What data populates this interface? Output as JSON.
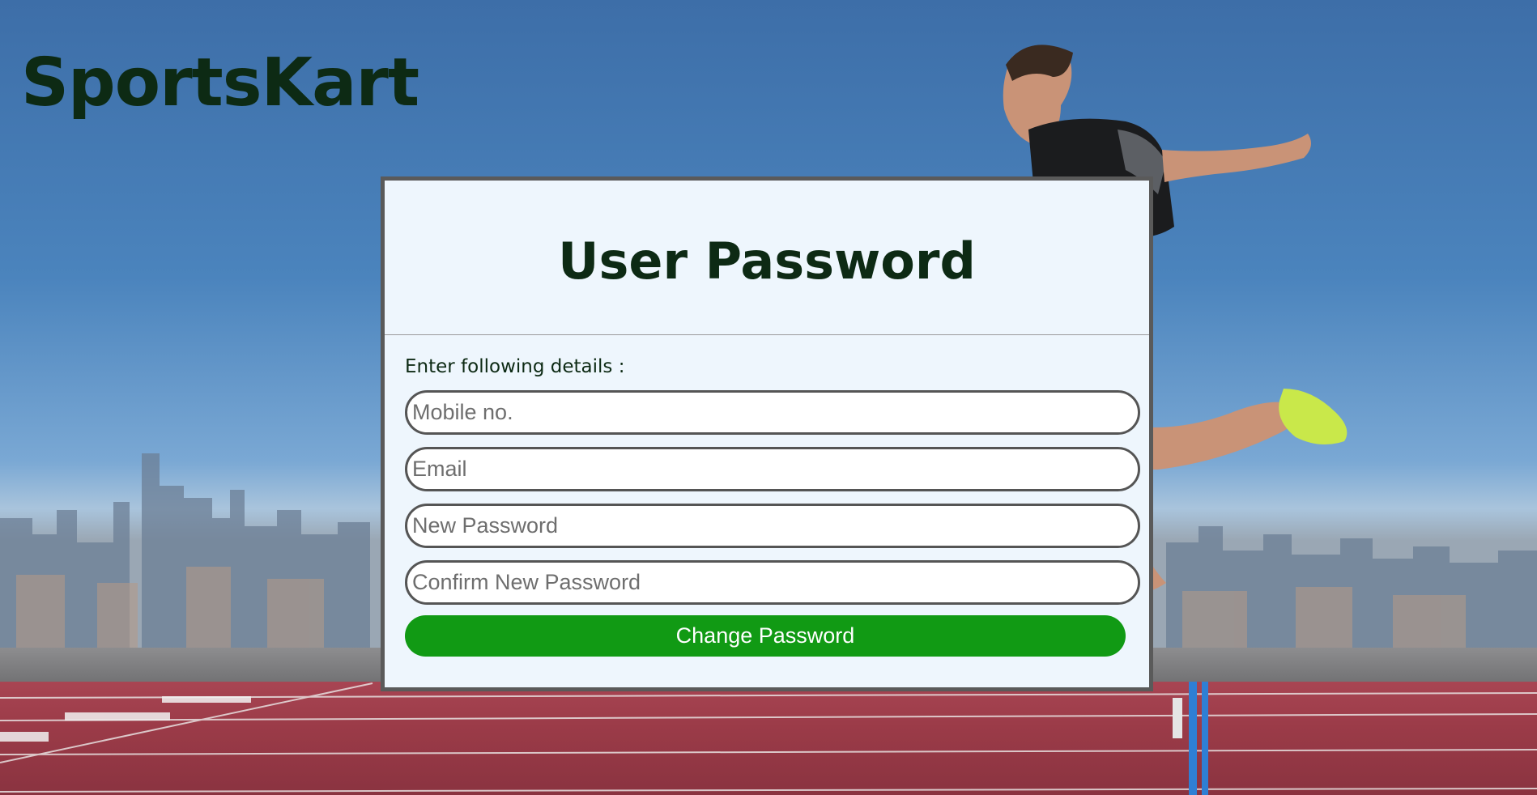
{
  "brand": {
    "name": "SportsKart"
  },
  "form": {
    "title": "User Password",
    "instructions": "Enter following details :",
    "fields": {
      "mobile_placeholder": "Mobile no.",
      "email_placeholder": "Email",
      "new_password_placeholder": "New Password",
      "confirm_password_placeholder": "Confirm New Password"
    },
    "submit_label": "Change Password"
  },
  "colors": {
    "brand_text": "#0d2a14",
    "card_background": "#eef6fd",
    "card_border": "#5a5a5a",
    "submit_button": "#119a14",
    "sky": "#4178b3",
    "track": "#9b3b48"
  },
  "background": {
    "scene": "athlete-hurdling-over-track-with-city-skyline"
  }
}
